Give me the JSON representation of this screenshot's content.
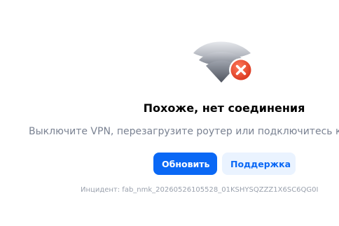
{
  "error": {
    "icon": "wifi-off-icon",
    "status_icon": "close-icon",
    "status_color": "#e8462a",
    "title": "Похоже, нет соединения",
    "message": "Выключите VPN, перезагрузите роутер или подключитесь к другой сети",
    "incident": "Инцидент: fab_nmk_20260526105528_01KSHYSQZZZ1X6SC6QG0I"
  },
  "actions": {
    "refresh_label": "Обновить",
    "support_label": "Поддержка"
  },
  "colors": {
    "accent": "#0a68f5",
    "accent_soft": "#eaf3ff",
    "muted_text": "#7a8292"
  }
}
